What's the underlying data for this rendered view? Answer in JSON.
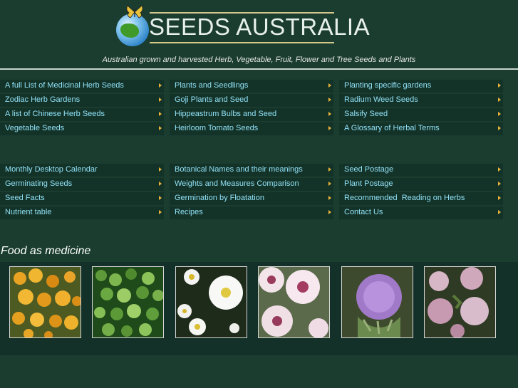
{
  "header": {
    "logo_text": "SEEDS AUSTRALIA",
    "tagline": "Australian grown and harvested Herb, Vegetable, Fruit, Flower and Tree Seeds and Plants"
  },
  "menu1": [
    [
      "A full List of Medicinal Herb Seeds",
      "Plants and Seedlings",
      "Planting specific gardens"
    ],
    [
      "Zodiac Herb Gardens",
      "Goji Plants and Seed",
      "Radium Weed Seeds"
    ],
    [
      "A list of Chinese Herb Seeds",
      "Hippeastrum Bulbs and Seed",
      "Salsify Seed"
    ],
    [
      "Vegetable Seeds",
      "Heirloom Tomato Seeds",
      "A Glossary of Herbal Terms"
    ]
  ],
  "menu2": [
    [
      "Monthly Desktop Calendar",
      "Botanical Names and their meanings",
      "Seed Postage"
    ],
    [
      "Germinating Seeds",
      "Weights and Measures Comparison",
      "Plant Postage"
    ],
    [
      "Seed Facts",
      "Germination by Floatation",
      "Recommended  Reading on Herbs"
    ],
    [
      "Nutrient table",
      "Recipes",
      "Contact Us"
    ]
  ],
  "section": {
    "title": "Food as medicine"
  },
  "colors": {
    "background": "#1a3d30",
    "menu_cell": "#143328",
    "menu_text": "#8fe0f6",
    "arrow": "#e8b23a"
  },
  "gallery": [
    {
      "icon": "marigold-flowers-photo"
    },
    {
      "icon": "parsley-photo"
    },
    {
      "icon": "daisy-flowers-photo"
    },
    {
      "icon": "hollyhock-flowers-photo"
    },
    {
      "icon": "artichoke-flower-photo"
    },
    {
      "icon": "red-clover-flowers-photo"
    }
  ]
}
